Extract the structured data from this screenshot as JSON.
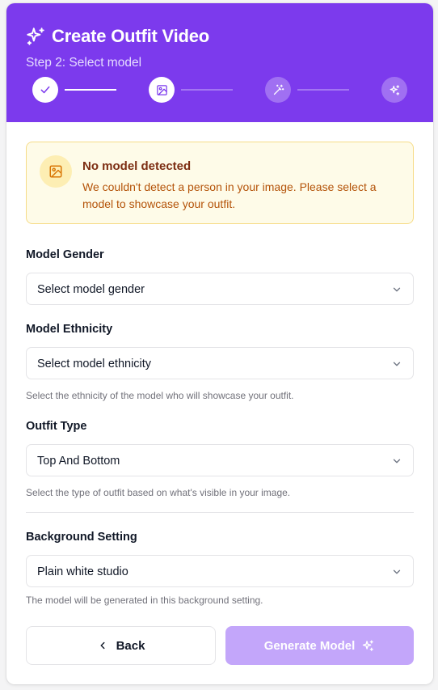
{
  "header": {
    "title": "Create Outfit Video",
    "subtitle": "Step 2: Select model",
    "color": "#7c3aed",
    "steps": [
      {
        "icon": "check-icon",
        "state": "done"
      },
      {
        "icon": "image-icon",
        "state": "active"
      },
      {
        "icon": "magic-wand-icon",
        "state": "pending"
      },
      {
        "icon": "sparkles-icon",
        "state": "pending"
      }
    ]
  },
  "alert": {
    "title": "No model detected",
    "message": "We couldn't detect a person in your image. Please select a model to showcase your outfit.",
    "icon": "image-icon"
  },
  "fields": {
    "gender": {
      "label": "Model Gender",
      "value": "Select model gender"
    },
    "ethnicity": {
      "label": "Model Ethnicity",
      "value": "Select model ethnicity",
      "help": "Select the ethnicity of the model who will showcase your outfit."
    },
    "outfit": {
      "label": "Outfit Type",
      "value": "Top And Bottom",
      "help": "Select the type of outfit based on what's visible in your image."
    },
    "background": {
      "label": "Background Setting",
      "value": "Plain white studio",
      "help": "The model will be generated in this background setting."
    }
  },
  "actions": {
    "back_label": "Back",
    "generate_label": "Generate Model"
  }
}
